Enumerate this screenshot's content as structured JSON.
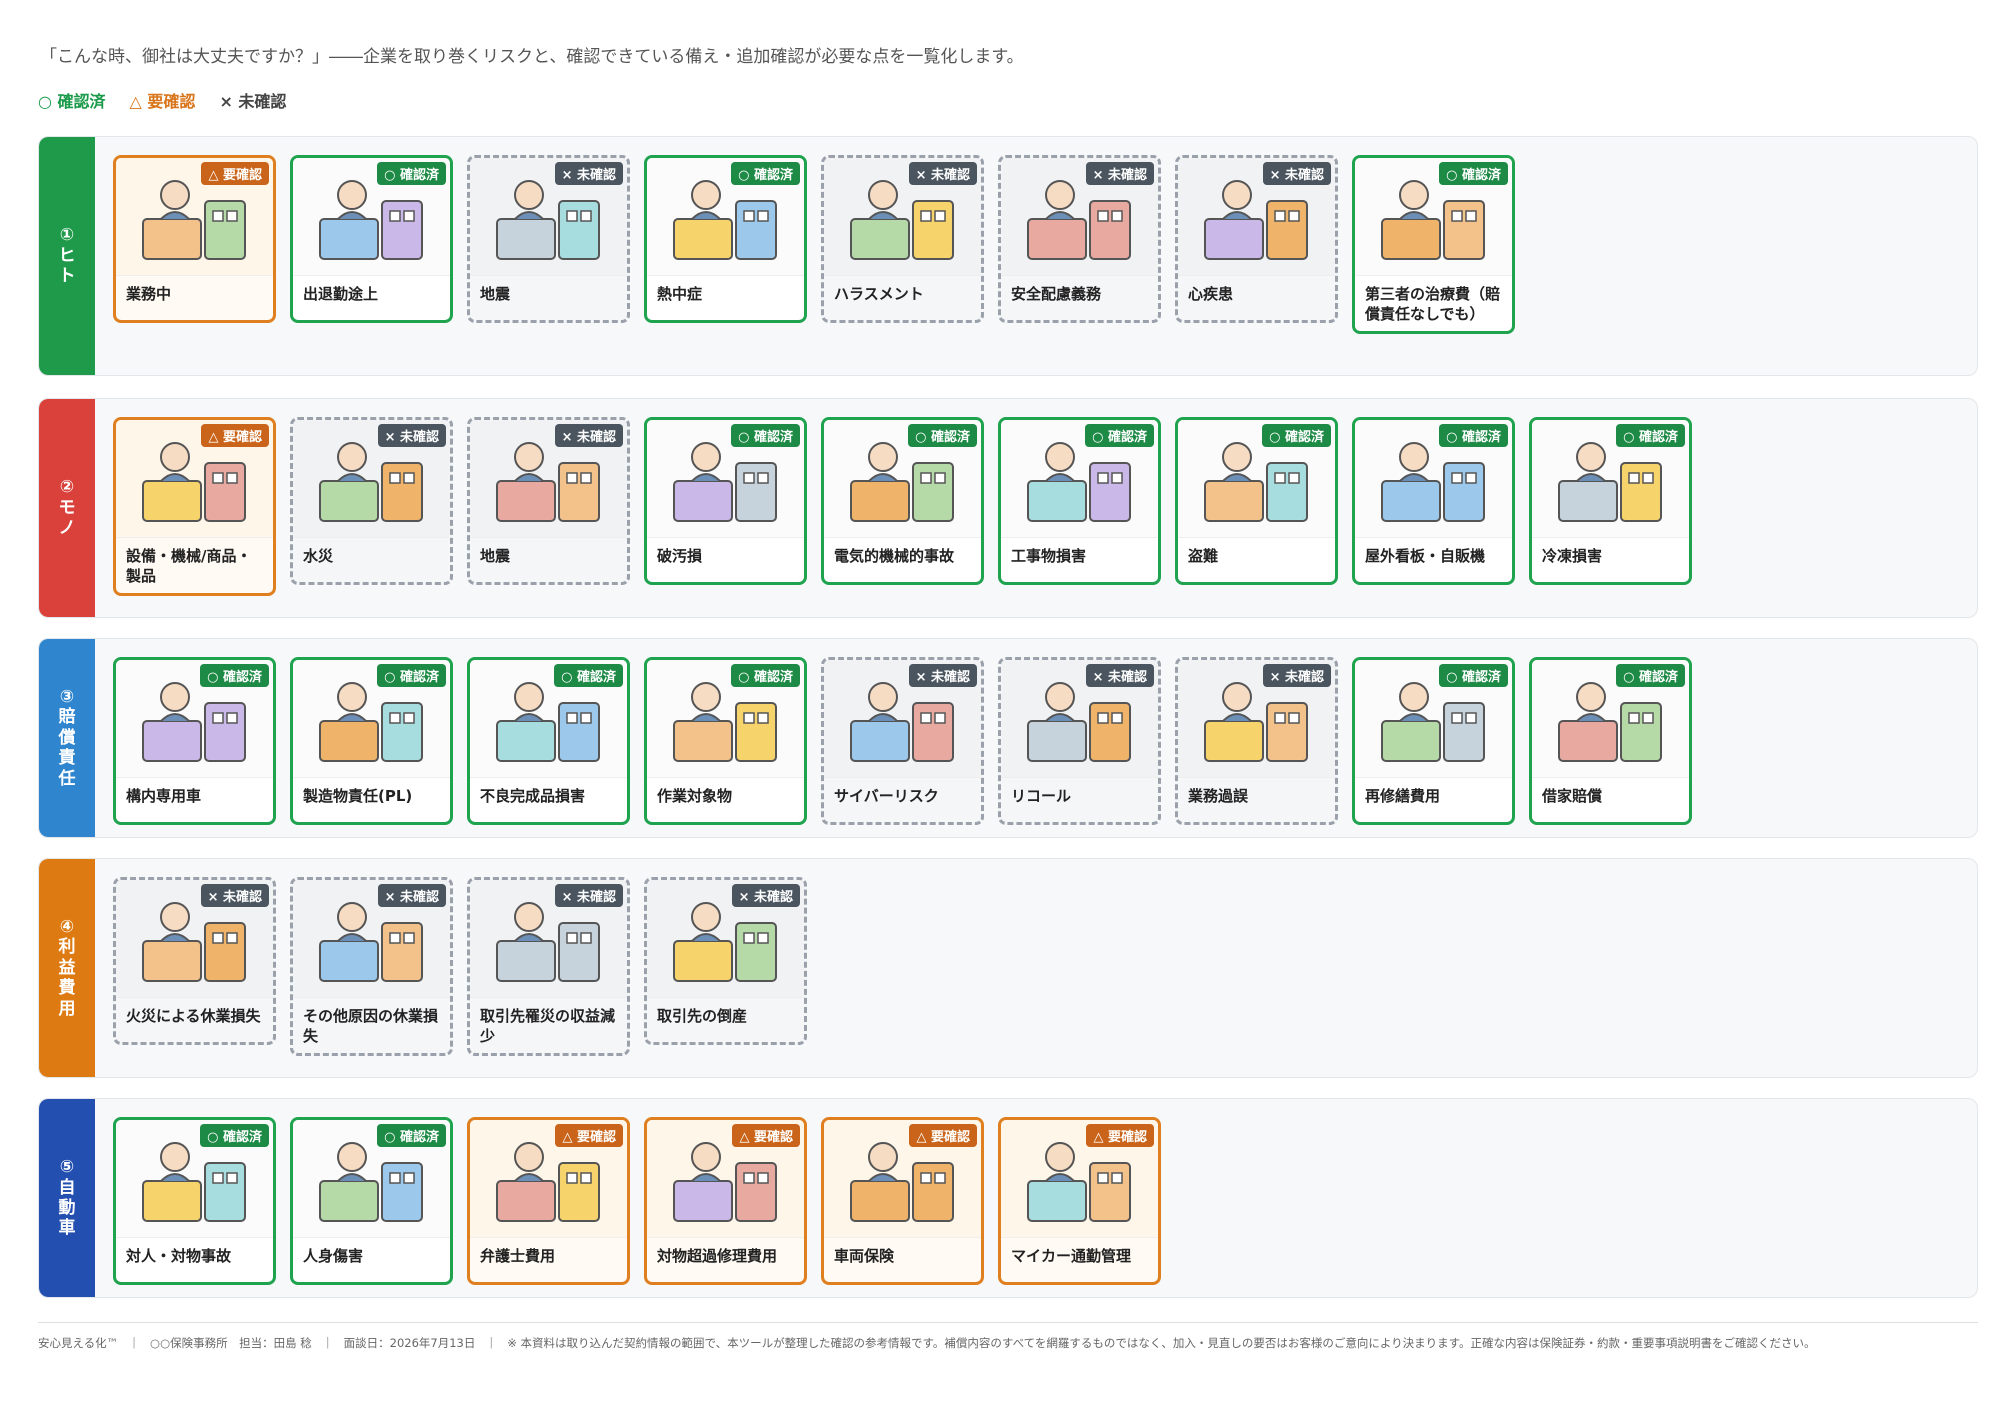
{
  "intro": "「こんな時、御社は大丈夫ですか？」――企業を取り巻くリスクと、確認できている備え・追加確認が必要な点を一覧化します。",
  "legend": {
    "ok": "○ 確認済",
    "check": "△ 要確認",
    "none": "× 未確認"
  },
  "badge_text": {
    "ok": "○ 確認済",
    "check": "△ 要確認",
    "none": "× 未確認"
  },
  "categories": [
    {
      "label": "①ヒト",
      "color": "#1f9a4a",
      "items": [
        {
          "label": "業務中",
          "status": "check"
        },
        {
          "label": "出退勤途上",
          "status": "ok"
        },
        {
          "label": "地震",
          "status": "none"
        },
        {
          "label": "熱中症",
          "status": "ok"
        },
        {
          "label": "ハラスメント",
          "status": "none"
        },
        {
          "label": "安全配慮義務",
          "status": "none"
        },
        {
          "label": "心疾患",
          "status": "none"
        },
        {
          "label": "第三者の治療費（賠償責任なしでも）",
          "status": "ok"
        }
      ]
    },
    {
      "label": "②モノ",
      "color": "#d9413a",
      "items": [
        {
          "label": "設備・機械/商品・製品",
          "status": "check"
        },
        {
          "label": "水災",
          "status": "none"
        },
        {
          "label": "地震",
          "status": "none"
        },
        {
          "label": "破汚損",
          "status": "ok"
        },
        {
          "label": "電気的機械的事故",
          "status": "ok"
        },
        {
          "label": "工事物損害",
          "status": "ok"
        },
        {
          "label": "盗難",
          "status": "ok"
        },
        {
          "label": "屋外看板・自販機",
          "status": "ok"
        },
        {
          "label": "冷凍損害",
          "status": "ok"
        }
      ]
    },
    {
      "label": "③賠償責任",
      "color": "#2f86cf",
      "items": [
        {
          "label": "構内専用車",
          "status": "ok"
        },
        {
          "label": "製造物責任(PL)",
          "status": "ok"
        },
        {
          "label": "不良完成品損害",
          "status": "ok"
        },
        {
          "label": "作業対象物",
          "status": "ok"
        },
        {
          "label": "サイバーリスク",
          "status": "none"
        },
        {
          "label": "リコール",
          "status": "none"
        },
        {
          "label": "業務過誤",
          "status": "none"
        },
        {
          "label": "再修繕費用",
          "status": "ok"
        },
        {
          "label": "借家賠償",
          "status": "ok"
        }
      ]
    },
    {
      "label": "④利益費用",
      "color": "#dd7a12",
      "items": [
        {
          "label": "火災による休業損失",
          "status": "none"
        },
        {
          "label": "その他原因の休業損失",
          "status": "none"
        },
        {
          "label": "取引先罹災の収益減少",
          "status": "none"
        },
        {
          "label": "取引先の倒産",
          "status": "none"
        }
      ]
    },
    {
      "label": "⑤自動車",
      "color": "#2350b0",
      "items": [
        {
          "label": "対人・対物事故",
          "status": "ok"
        },
        {
          "label": "人身傷害",
          "status": "ok"
        },
        {
          "label": "弁護士費用",
          "status": "check"
        },
        {
          "label": "対物超過修理費用",
          "status": "check"
        },
        {
          "label": "車両保険",
          "status": "check"
        },
        {
          "label": "マイカー通勤管理",
          "status": "check"
        }
      ]
    }
  ],
  "footer": {
    "brand": "安心見える化™",
    "office": "○○保険事務所　担当：田島 稔",
    "date": "面談日：2026年7月13日",
    "note": "※ 本資料は取り込んだ契約情報の範囲で、本ツールが整理した確認の参考情報です。補償内容のすべてを網羅するものではなく、加入・見直しの要否はお客様のご意向により決まります。正確な内容は保険証券・約款・重要事項説明書をご確認ください。"
  }
}
